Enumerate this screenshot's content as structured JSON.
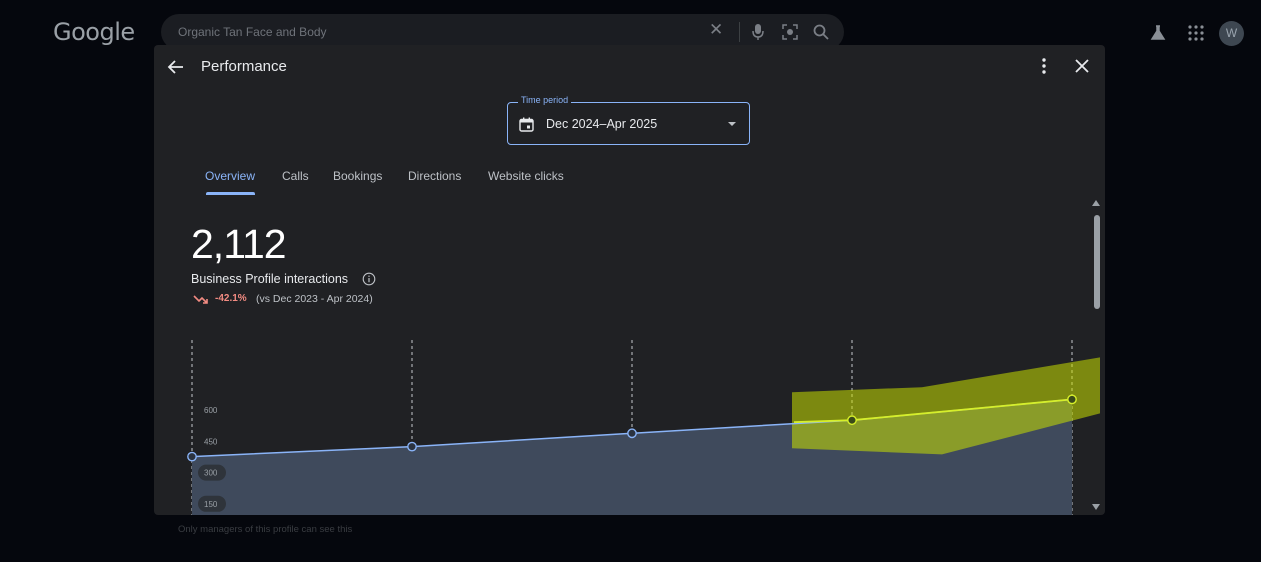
{
  "browser": {
    "logo": "Google",
    "search_query": "Organic Tan Face and Body",
    "avatar_letter": "W"
  },
  "dialog": {
    "title": "Performance",
    "time_period": {
      "label": "Time period",
      "value": "Dec 2024–Apr 2025"
    },
    "tabs": [
      {
        "label": "Overview",
        "active": true
      },
      {
        "label": "Calls",
        "active": false
      },
      {
        "label": "Bookings",
        "active": false
      },
      {
        "label": "Directions",
        "active": false
      },
      {
        "label": "Website clicks",
        "active": false
      }
    ],
    "total": "2,112",
    "metric_label": "Business Profile interactions",
    "change": "-42.1%",
    "comparison": "(vs Dec 2023 - Apr 2024)",
    "footer_note": "Only managers of this profile can see this"
  },
  "colors": {
    "accent": "#8ab4f8",
    "negative": "#f28b82",
    "highlight": "#c8e000",
    "area_fill": "#3f4a5c"
  },
  "chart_data": {
    "type": "area",
    "y_ticks": [
      "600",
      "450",
      "300",
      "150"
    ],
    "ylim": [
      0,
      600
    ],
    "x": [
      0,
      1,
      2,
      3,
      4
    ],
    "values": [
      300,
      348,
      412,
      475,
      575
    ],
    "grid": "vertical dashed",
    "highlighted_segment": [
      3,
      4
    ]
  }
}
